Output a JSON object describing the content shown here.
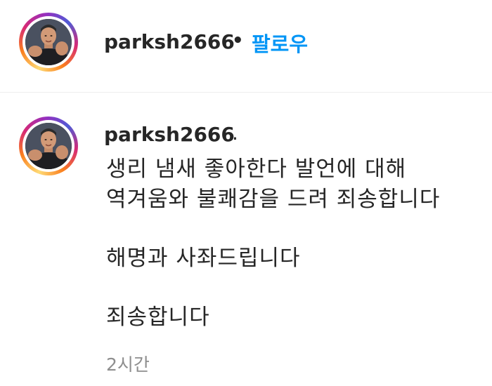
{
  "post_header": {
    "username": "parksh2666",
    "separator": "•",
    "follow_label": "팔로우"
  },
  "comment": {
    "username": "parksh2666",
    "username_suffix": ".",
    "lines": [
      "생리 냄새 좋아한다 발언에 대해",
      "역겨움와 불쾌감을 드려 죄송합니다",
      "해명과 사좌드립니다",
      "죄송합니다"
    ],
    "timestamp": "2시간"
  },
  "colors": {
    "follow_blue": "#0095f6",
    "text": "#262626",
    "muted": "#8e8e8e"
  },
  "icons": {
    "avatar": "profile-photo-icon"
  }
}
